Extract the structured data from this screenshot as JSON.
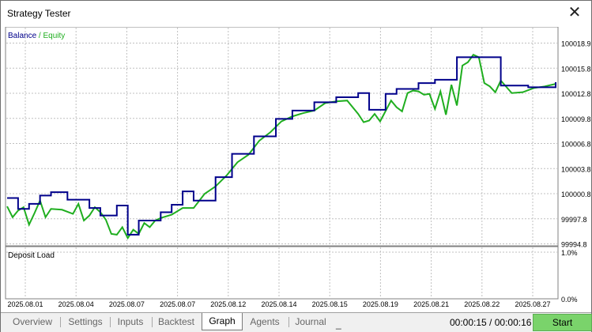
{
  "window": {
    "title": "Strategy Tester",
    "close_glyph": "✕",
    "close_icon": "close-icon"
  },
  "colors": {
    "balance": "#00008b",
    "equity": "#1fae1f",
    "grid": "#c0c0c0",
    "start_button": "#7ad36b"
  },
  "chart_data": [
    {
      "type": "line",
      "legend": {
        "balance_label": "Balance",
        "separator": " / ",
        "equity_label": "Equity",
        "placement": "top-left"
      },
      "grid": true,
      "ylim": [
        99994.8,
        100020.8
      ],
      "yticks": [
        "100018.9",
        "100015.8",
        "100012.8",
        "100009.8",
        "100006.8",
        "100003.8",
        "100000.8",
        "99997.8",
        "99994.8"
      ],
      "xticks": [
        "2025.08.01",
        "2025.08.04",
        "2025.08.07",
        "2025.08.07",
        "2025.08.12",
        "2025.08.14",
        "2025.08.15",
        "2025.08.19",
        "2025.08.21",
        "2025.08.22",
        "2025.08.27"
      ],
      "series": [
        {
          "name": "Balance",
          "x": [
            0,
            2,
            4,
            6,
            8,
            11,
            15,
            17,
            20,
            22,
            24,
            26,
            28,
            30,
            32,
            34,
            38,
            41,
            45,
            49,
            52,
            56,
            60,
            64,
            66,
            69,
            71,
            75,
            78,
            82,
            85,
            90,
            95,
            100
          ],
          "values": [
            100000.3,
            99999.0,
            99999.6,
            100000.6,
            100001.0,
            100000.1,
            99999.1,
            99998.2,
            99999.4,
            99995.9,
            99997.6,
            99997.6,
            99998.6,
            99999.5,
            100001.1,
            100000.0,
            100002.8,
            100005.6,
            100007.7,
            100009.8,
            100010.8,
            100011.8,
            100012.4,
            100012.9,
            100010.9,
            100012.8,
            100013.4,
            100014.1,
            100014.5,
            100017.2,
            100017.2,
            100013.8,
            100013.6,
            100014.2
          ]
        },
        {
          "name": "Equity",
          "x": [
            0,
            1,
            2,
            3,
            4,
            5,
            6,
            7,
            8,
            10,
            12,
            13,
            14,
            15,
            16,
            17,
            18,
            19,
            20,
            21,
            22,
            23,
            24,
            25,
            26,
            27,
            28,
            30,
            32,
            34,
            36,
            38,
            40,
            42,
            44,
            46,
            48,
            50,
            52,
            54,
            56,
            58,
            60,
            62,
            64,
            65,
            66,
            67,
            68,
            70,
            71,
            72,
            73,
            74,
            75,
            76,
            77,
            78,
            79,
            80,
            81,
            82,
            83,
            84,
            85,
            86,
            87,
            88,
            89,
            90,
            92,
            94,
            96,
            98,
            100
          ],
          "values": [
            99999.3,
            99998.0,
            99998.8,
            99999.2,
            99997.1,
            99998.5,
            100000.0,
            99998.0,
            99999.0,
            99998.9,
            99998.4,
            99999.6,
            99997.6,
            99998.2,
            99999.2,
            99998.6,
            99997.7,
            99996.0,
            99995.9,
            99996.8,
            99995.5,
            99996.5,
            99996.0,
            99997.3,
            99996.8,
            99997.6,
            99997.9,
            99998.3,
            99999.1,
            99999.1,
            100000.8,
            100001.7,
            100003.0,
            100004.6,
            100005.5,
            100007.2,
            100008.2,
            100009.5,
            100010.1,
            100010.5,
            100010.8,
            100011.7,
            100011.9,
            100012.0,
            100010.4,
            100009.4,
            100009.6,
            100010.4,
            100009.5,
            100012.0,
            100011.2,
            100010.7,
            100012.9,
            100013.2,
            100013.1,
            100012.7,
            100012.8,
            100011.0,
            100013.1,
            100010.3,
            100013.9,
            100011.4,
            100016.2,
            100016.6,
            100017.5,
            100017.2,
            100014.1,
            100013.7,
            100013.0,
            100014.4,
            100012.9,
            100013.0,
            100013.5,
            100013.7,
            100014.0
          ]
        }
      ]
    },
    {
      "type": "area",
      "title": "Deposit Load",
      "yticks": [
        "1.0%",
        "0.0%"
      ],
      "series": [
        {
          "values": []
        }
      ]
    }
  ],
  "tabs": [
    {
      "label": "Overview",
      "active": false
    },
    {
      "label": "Settings",
      "active": false
    },
    {
      "label": "Inputs",
      "active": false
    },
    {
      "label": "Backtest",
      "active": false
    },
    {
      "label": "Graph",
      "active": true
    },
    {
      "label": "Agents",
      "active": false
    },
    {
      "label": "Journal",
      "active": false
    }
  ],
  "status": {
    "extra_glyph": "_",
    "time_elapsed": "00:00:15",
    "time_separator": " / ",
    "time_total": "00:00:16",
    "start_label": "Start"
  }
}
